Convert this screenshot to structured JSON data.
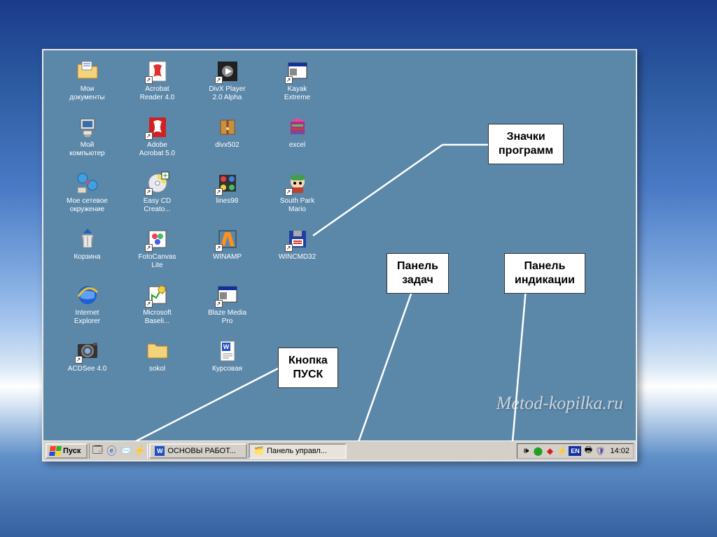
{
  "icons": [
    {
      "label": "Мои\nдокументы",
      "type": "folder-docs",
      "shortcut": false
    },
    {
      "label": "Acrobat\nReader 4.0",
      "type": "acrobat",
      "shortcut": true
    },
    {
      "label": "DivX Player\n2.0 Alpha",
      "type": "divx-player",
      "shortcut": true
    },
    {
      "label": "Kayak\nExtreme",
      "type": "app-window",
      "shortcut": true
    },
    {
      "label": "Мой\nкомпьютер",
      "type": "my-computer",
      "shortcut": false
    },
    {
      "label": "Adobe\nAcrobat 5.0",
      "type": "acrobat-red",
      "shortcut": true
    },
    {
      "label": "divx502",
      "type": "archive",
      "shortcut": false
    },
    {
      "label": "excel",
      "type": "winrar",
      "shortcut": false
    },
    {
      "label": "Мое сетевое\nокружение",
      "type": "network",
      "shortcut": false
    },
    {
      "label": "Easy CD\nCreato...",
      "type": "cd",
      "shortcut": true
    },
    {
      "label": "lines98",
      "type": "lines",
      "shortcut": true
    },
    {
      "label": "South Park\nMario",
      "type": "southpark",
      "shortcut": true
    },
    {
      "label": "Корзина",
      "type": "recycle",
      "shortcut": false
    },
    {
      "label": "FotoCanvas\nLite",
      "type": "fotocanvas",
      "shortcut": true
    },
    {
      "label": "WINAMP",
      "type": "winamp",
      "shortcut": true
    },
    {
      "label": "WINCMD32",
      "type": "floppy",
      "shortcut": true
    },
    {
      "label": "Internet\nExplorer",
      "type": "ie",
      "shortcut": false
    },
    {
      "label": "Microsoft\nBaseli...",
      "type": "baseline",
      "shortcut": true
    },
    {
      "label": "Blaze Media\nPro",
      "type": "app-window",
      "shortcut": true
    },
    {
      "label": "",
      "type": "",
      "shortcut": false
    },
    {
      "label": "ACDSee 4.0",
      "type": "acdsee",
      "shortcut": true
    },
    {
      "label": "sokol",
      "type": "folder",
      "shortcut": false
    },
    {
      "label": "Курсовая",
      "type": "word-doc",
      "shortcut": false
    }
  ],
  "callouts": {
    "programs": "Значки\nпрограмм",
    "taskbar": "Панель\nзадач",
    "tray": "Панель\nиндикации",
    "start": "Кнопка\nПУСК"
  },
  "watermark": "Metod-kopilka.ru",
  "taskbar": {
    "start": "Пуск",
    "task1": "ОСНОВЫ РАБОТ...",
    "task2": "Панель управл...",
    "lang": "EN",
    "clock": "14:02"
  }
}
